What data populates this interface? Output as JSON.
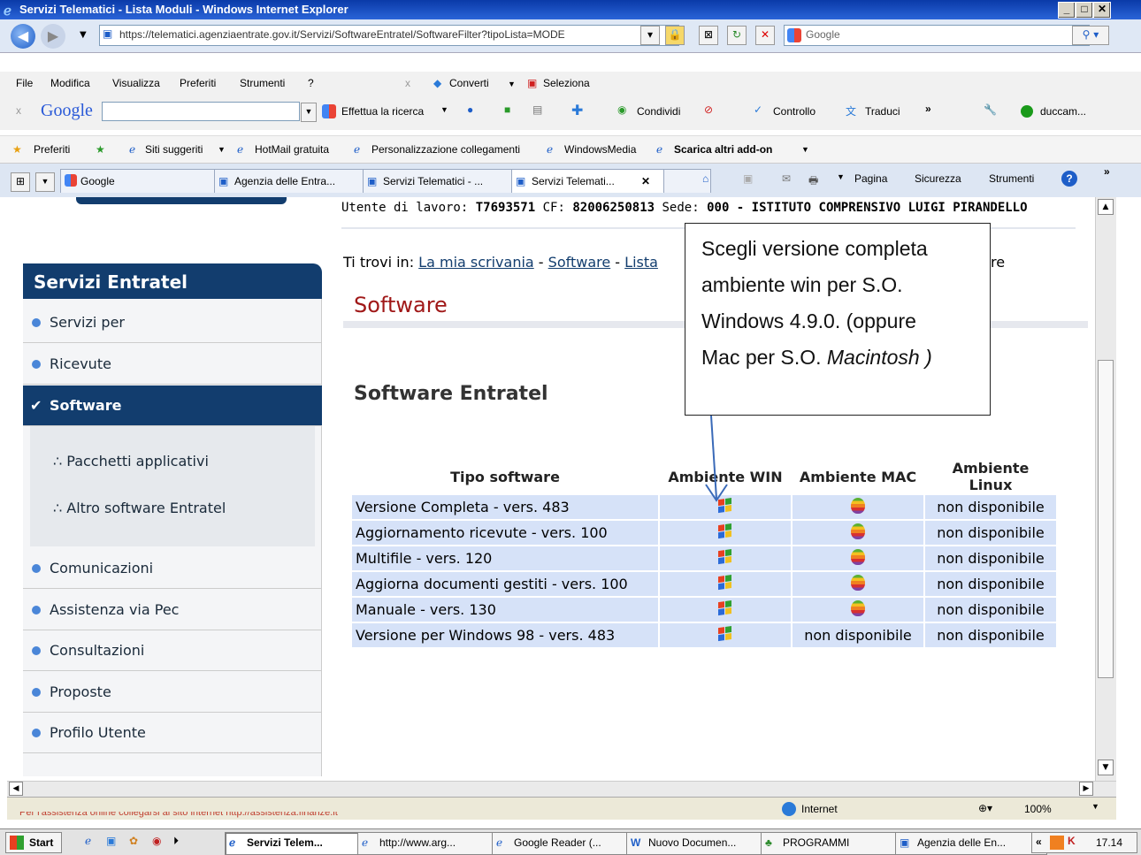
{
  "window": {
    "title": "Servizi Telematici - Lista Moduli - Windows Internet Explorer"
  },
  "address": {
    "url": "https://telematici.agenziaentrate.gov.it/Servizi/SoftwareEntratel/SoftwareFilter?tipoLista=MODE",
    "search_placeholder": "Google"
  },
  "menu": {
    "items": [
      "File",
      "Modifica",
      "Visualizza",
      "Preferiti",
      "Strumenti",
      "?"
    ],
    "converti": "Converti",
    "seleziona": "Seleziona"
  },
  "google_toolbar": {
    "logo": "Google",
    "search_label": "Effettua la ricerca",
    "condividi": "Condividi",
    "controllo": "Controllo",
    "traduci": "Traduci",
    "user": "duccam..."
  },
  "favorites": {
    "preferiti": "Preferiti",
    "items": [
      "Siti suggeriti",
      "HotMail gratuita",
      "Personalizzazione collegamenti",
      "WindowsMedia",
      "Scarica altri add-on"
    ]
  },
  "tabs": {
    "items": [
      "Google",
      "Agenzia delle Entra...",
      "Servizi Telematici - ...",
      "Servizi Telemati..."
    ],
    "cmd": [
      "Pagina",
      "Sicurezza",
      "Strumenti"
    ]
  },
  "page": {
    "user_info_prefix": "Utente di lavoro:",
    "user_id": "T7693571",
    "cf_label": "CF:",
    "cf": "82006250813",
    "sede_label": "Sede:",
    "sede": "000 - ISTITUTO COMPRENSIVO LUIGI PIRANDELLO",
    "breadcrumb_prefix": "Ti trovi in:",
    "breadcrumb": [
      "La mia scrivania",
      "Software",
      "Lista"
    ],
    "breadcrumb_tail": "re",
    "heading": "Software",
    "subheading": "Software Entratel"
  },
  "sidebar": {
    "title": "Servizi Entratel",
    "items": [
      "Servizi per",
      "Ricevute",
      "Software",
      "Comunicazioni",
      "Assistenza via Pec",
      "Consultazioni",
      "Proposte",
      "Profilo Utente"
    ],
    "subitems": [
      "Pacchetti applicativi",
      "Altro software Entratel"
    ]
  },
  "table": {
    "headers": [
      "Tipo software",
      "Ambiente WIN",
      "Ambiente MAC",
      "Ambiente Linux"
    ],
    "rows": [
      {
        "name": "Versione Completa - vers. 483",
        "mac": "apple",
        "linux": "non disponibile"
      },
      {
        "name": "Aggiornamento ricevute - vers. 100",
        "mac": "apple",
        "linux": "non disponibile"
      },
      {
        "name": "Multifile - vers. 120",
        "mac": "apple",
        "linux": "non disponibile"
      },
      {
        "name": "Aggiorna documenti gestiti - vers. 100",
        "mac": "apple",
        "linux": "non disponibile"
      },
      {
        "name": "Manuale - vers. 130",
        "mac": "apple",
        "linux": "non disponibile"
      },
      {
        "name": "Versione per Windows 98 - vers. 483",
        "mac": "non disponibile",
        "linux": "non disponibile"
      }
    ]
  },
  "callout": {
    "line1": "Scegli versione completa",
    "line2": "ambiente win per S.O.",
    "line3": "Windows  4.9.0. (oppure",
    "line4a": "Mac per S.O. ",
    "line4b": "Macintosh )"
  },
  "status": {
    "zone": "Internet",
    "zoom": "100%",
    "behind_text": "Per l'assistenza online collegarsi al sito internet http://assistenza.finanze.it"
  },
  "taskbar": {
    "start": "Start",
    "items": [
      "Servizi Telem...",
      "http://www.arg...",
      "Google Reader (...",
      "Nuovo Documen...",
      "PROGRAMMI",
      "Agenzia delle En..."
    ],
    "clock": "17.14"
  }
}
